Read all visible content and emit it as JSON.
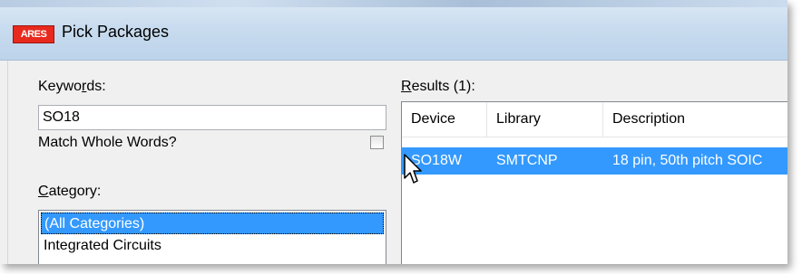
{
  "window": {
    "title": "Pick Packages",
    "app_icon_text": "ARES"
  },
  "keywords": {
    "label_prefix": "Keywo",
    "label_accel": "r",
    "label_suffix": "ds:",
    "value": "SO18"
  },
  "match_whole_words": {
    "label": "Match Whole Words?",
    "checked": false
  },
  "category": {
    "label_accel": "C",
    "label_suffix": "ategory:",
    "items": [
      "(All Categories)",
      "Integrated Circuits"
    ],
    "selected_index": 0
  },
  "results": {
    "label_accel": "R",
    "label_suffix": "esults (1):",
    "columns": [
      "Device",
      "Library",
      "Description"
    ],
    "rows": [
      {
        "device": "SO18W",
        "library": "SMTCNP",
        "description": "18 pin, 50th pitch SOIC"
      }
    ]
  },
  "colors": {
    "selection": "#3399ff",
    "app_icon": "#e8291d"
  }
}
